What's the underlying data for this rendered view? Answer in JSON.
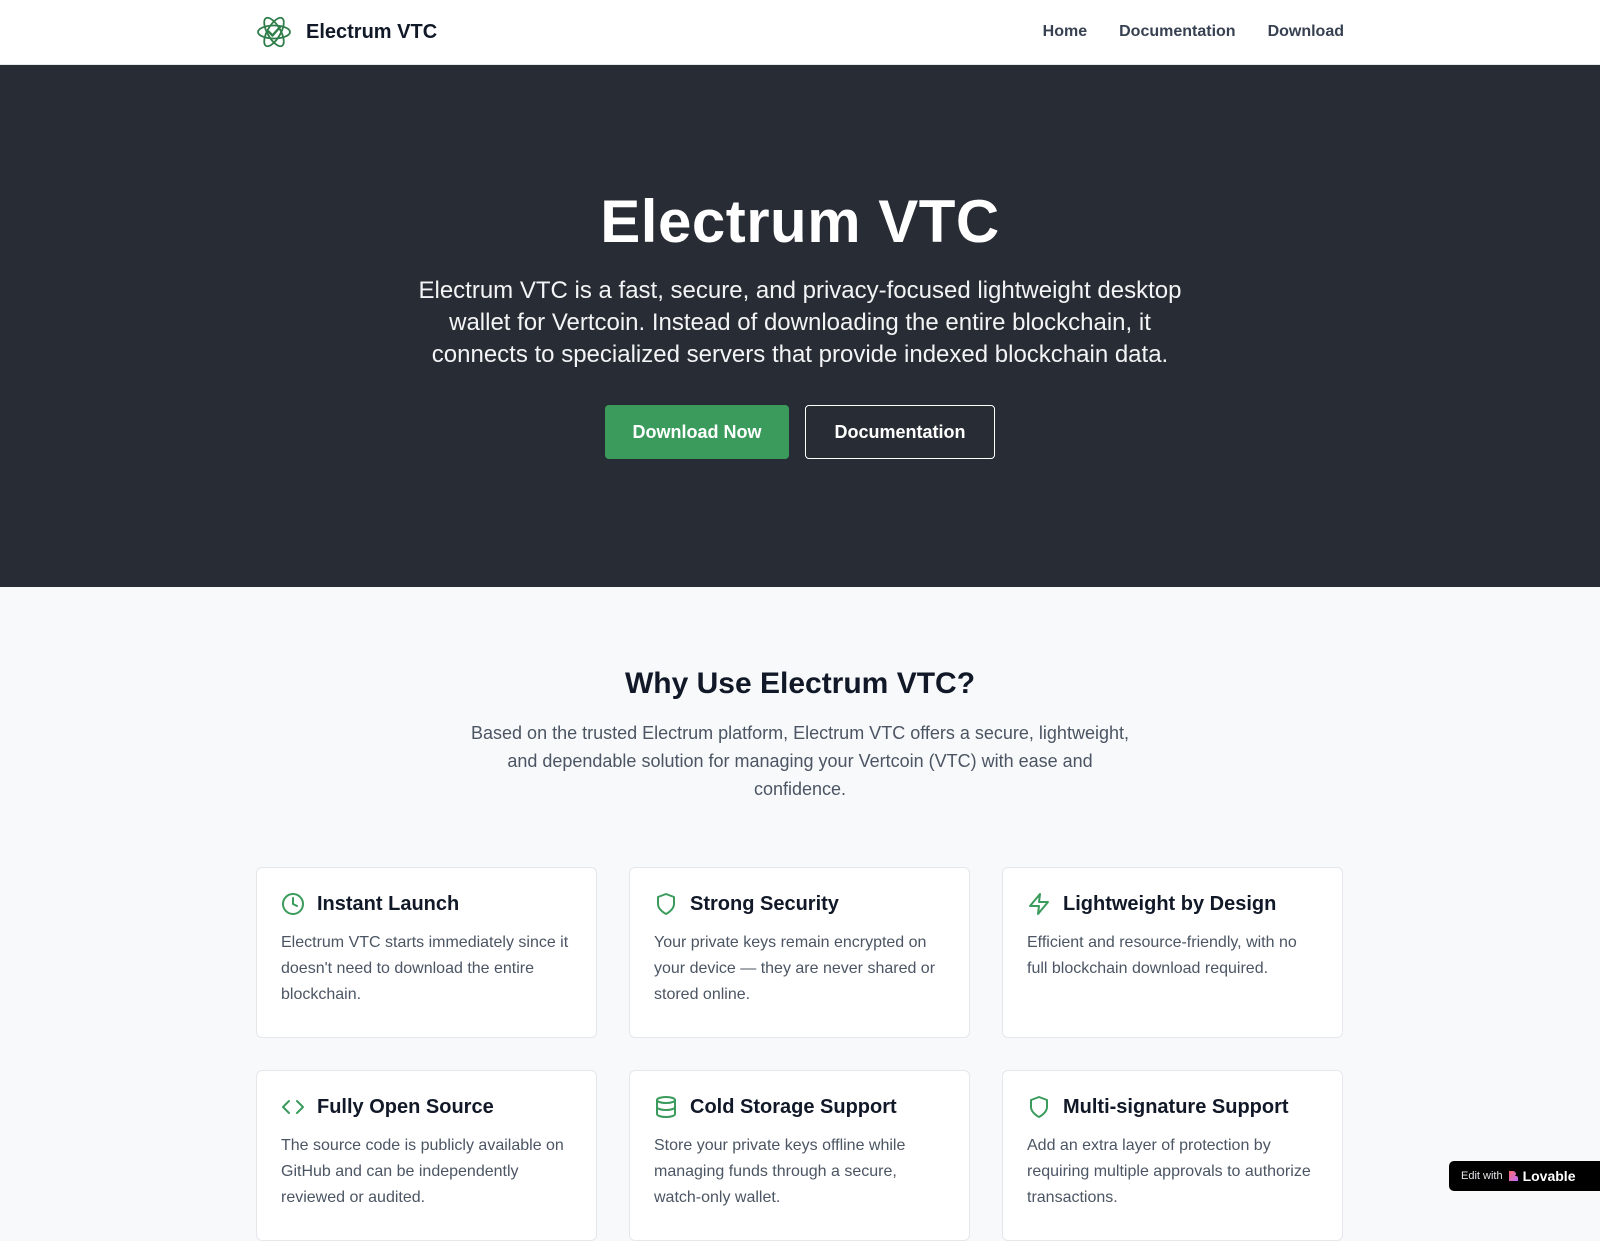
{
  "header": {
    "brand_name": "Electrum VTC",
    "logo_icon": "atom-check-logo",
    "nav": [
      {
        "label": "Home"
      },
      {
        "label": "Documentation"
      },
      {
        "label": "Download"
      }
    ]
  },
  "hero": {
    "title": "Electrum VTC",
    "description": "Electrum VTC is a fast, secure, and privacy-focused lightweight desktop wallet for Vertcoin. Instead of downloading the entire blockchain, it connects to specialized servers that provide indexed blockchain data.",
    "primary_button": "Download Now",
    "secondary_button": "Documentation"
  },
  "features": {
    "title": "Why Use Electrum VTC?",
    "description": "Based on the trusted Electrum platform, Electrum VTC offers a secure, lightweight, and dependable solution for managing your Vertcoin (VTC) with ease and confidence.",
    "cards": [
      {
        "icon": "clock-icon",
        "title": "Instant Launch",
        "text": "Electrum VTC starts immediately since it doesn't need to download the entire blockchain."
      },
      {
        "icon": "shield-icon",
        "title": "Strong Security",
        "text": "Your private keys remain encrypted on your device — they are never shared or stored online."
      },
      {
        "icon": "lightning-icon",
        "title": "Lightweight by Design",
        "text": "Efficient and resource-friendly, with no full blockchain download required."
      },
      {
        "icon": "code-icon",
        "title": "Fully Open Source",
        "text": "The source code is publicly available on GitHub and can be independently reviewed or audited."
      },
      {
        "icon": "database-icon",
        "title": "Cold Storage Support",
        "text": "Store your private keys offline while managing funds through a secure, watch-only wallet."
      },
      {
        "icon": "shield-icon",
        "title": "Multi-signature Support",
        "text": "Add an extra layer of protection by requiring multiple approvals to authorize transactions."
      }
    ]
  },
  "badge": {
    "edit_text": "Edit with",
    "name": "Lovable",
    "close": "✕"
  },
  "colors": {
    "accent": "#3a9b5c",
    "hero_bg": "#282c34",
    "page_bg": "#f8f9fb"
  }
}
